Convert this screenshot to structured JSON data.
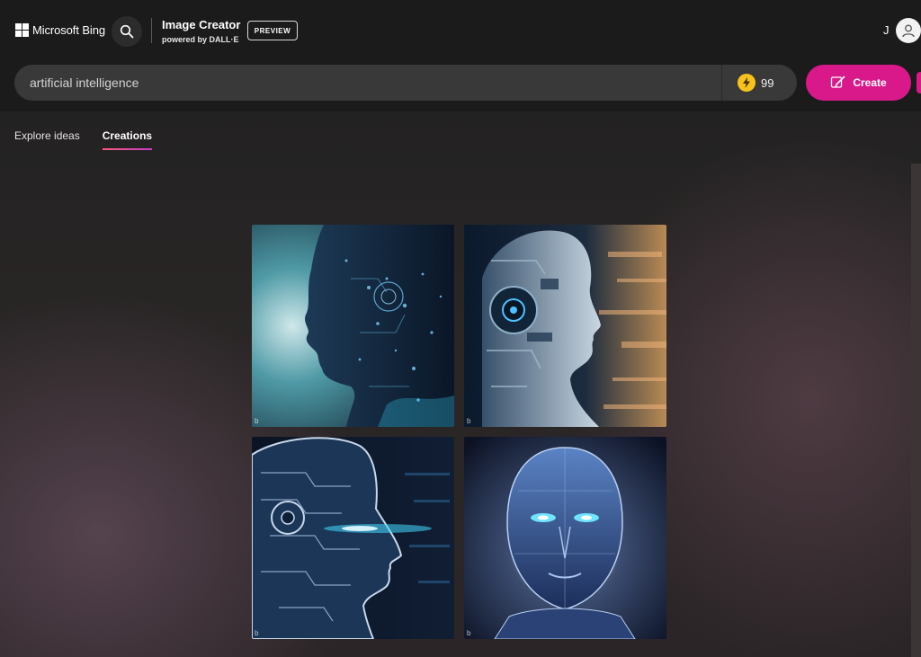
{
  "header": {
    "brand_name": "Microsoft Bing",
    "product_title": "Image Creator",
    "product_subtitle": "powered by DALL·E",
    "badge": "PREVIEW",
    "user_initial": "J"
  },
  "search": {
    "value": "artificial intelligence",
    "boost_count": "99",
    "create_label": "Create"
  },
  "tabs": [
    {
      "label": "Explore ideas",
      "active": false
    },
    {
      "label": "Creations",
      "active": true
    }
  ],
  "images": [
    {
      "watermark": "b"
    },
    {
      "watermark": "b"
    },
    {
      "watermark": "b"
    },
    {
      "watermark": "b"
    }
  ],
  "colors": {
    "accent": "#d9198a",
    "boost_coin": "#f6c21b",
    "header_bg": "#1c1b1b"
  },
  "icons": {
    "search": "search-icon",
    "avatar": "user-avatar-icon",
    "boost": "lightning-icon",
    "create": "create-brush-icon"
  }
}
